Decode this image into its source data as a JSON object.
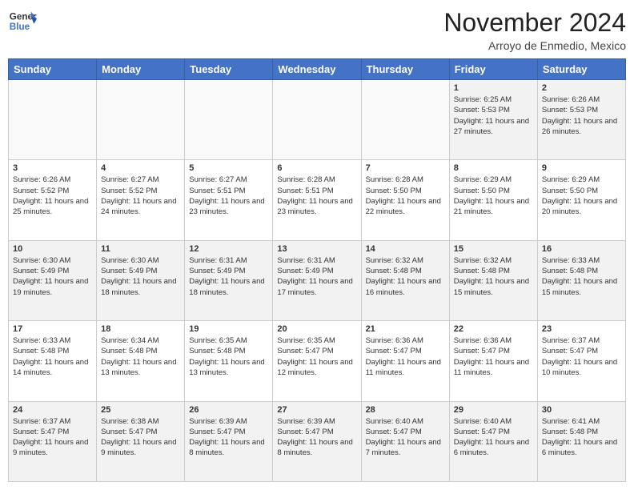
{
  "logo": {
    "line1": "General",
    "line2": "Blue"
  },
  "title": "November 2024",
  "location": "Arroyo de Enmedio, Mexico",
  "days_of_week": [
    "Sunday",
    "Monday",
    "Tuesday",
    "Wednesday",
    "Thursday",
    "Friday",
    "Saturday"
  ],
  "weeks": [
    [
      {
        "day": "",
        "info": ""
      },
      {
        "day": "",
        "info": ""
      },
      {
        "day": "",
        "info": ""
      },
      {
        "day": "",
        "info": ""
      },
      {
        "day": "",
        "info": ""
      },
      {
        "day": "1",
        "info": "Sunrise: 6:25 AM\nSunset: 5:53 PM\nDaylight: 11 hours and 27 minutes."
      },
      {
        "day": "2",
        "info": "Sunrise: 6:26 AM\nSunset: 5:53 PM\nDaylight: 11 hours and 26 minutes."
      }
    ],
    [
      {
        "day": "3",
        "info": "Sunrise: 6:26 AM\nSunset: 5:52 PM\nDaylight: 11 hours and 25 minutes."
      },
      {
        "day": "4",
        "info": "Sunrise: 6:27 AM\nSunset: 5:52 PM\nDaylight: 11 hours and 24 minutes."
      },
      {
        "day": "5",
        "info": "Sunrise: 6:27 AM\nSunset: 5:51 PM\nDaylight: 11 hours and 23 minutes."
      },
      {
        "day": "6",
        "info": "Sunrise: 6:28 AM\nSunset: 5:51 PM\nDaylight: 11 hours and 23 minutes."
      },
      {
        "day": "7",
        "info": "Sunrise: 6:28 AM\nSunset: 5:50 PM\nDaylight: 11 hours and 22 minutes."
      },
      {
        "day": "8",
        "info": "Sunrise: 6:29 AM\nSunset: 5:50 PM\nDaylight: 11 hours and 21 minutes."
      },
      {
        "day": "9",
        "info": "Sunrise: 6:29 AM\nSunset: 5:50 PM\nDaylight: 11 hours and 20 minutes."
      }
    ],
    [
      {
        "day": "10",
        "info": "Sunrise: 6:30 AM\nSunset: 5:49 PM\nDaylight: 11 hours and 19 minutes."
      },
      {
        "day": "11",
        "info": "Sunrise: 6:30 AM\nSunset: 5:49 PM\nDaylight: 11 hours and 18 minutes."
      },
      {
        "day": "12",
        "info": "Sunrise: 6:31 AM\nSunset: 5:49 PM\nDaylight: 11 hours and 18 minutes."
      },
      {
        "day": "13",
        "info": "Sunrise: 6:31 AM\nSunset: 5:49 PM\nDaylight: 11 hours and 17 minutes."
      },
      {
        "day": "14",
        "info": "Sunrise: 6:32 AM\nSunset: 5:48 PM\nDaylight: 11 hours and 16 minutes."
      },
      {
        "day": "15",
        "info": "Sunrise: 6:32 AM\nSunset: 5:48 PM\nDaylight: 11 hours and 15 minutes."
      },
      {
        "day": "16",
        "info": "Sunrise: 6:33 AM\nSunset: 5:48 PM\nDaylight: 11 hours and 15 minutes."
      }
    ],
    [
      {
        "day": "17",
        "info": "Sunrise: 6:33 AM\nSunset: 5:48 PM\nDaylight: 11 hours and 14 minutes."
      },
      {
        "day": "18",
        "info": "Sunrise: 6:34 AM\nSunset: 5:48 PM\nDaylight: 11 hours and 13 minutes."
      },
      {
        "day": "19",
        "info": "Sunrise: 6:35 AM\nSunset: 5:48 PM\nDaylight: 11 hours and 13 minutes."
      },
      {
        "day": "20",
        "info": "Sunrise: 6:35 AM\nSunset: 5:47 PM\nDaylight: 11 hours and 12 minutes."
      },
      {
        "day": "21",
        "info": "Sunrise: 6:36 AM\nSunset: 5:47 PM\nDaylight: 11 hours and 11 minutes."
      },
      {
        "day": "22",
        "info": "Sunrise: 6:36 AM\nSunset: 5:47 PM\nDaylight: 11 hours and 11 minutes."
      },
      {
        "day": "23",
        "info": "Sunrise: 6:37 AM\nSunset: 5:47 PM\nDaylight: 11 hours and 10 minutes."
      }
    ],
    [
      {
        "day": "24",
        "info": "Sunrise: 6:37 AM\nSunset: 5:47 PM\nDaylight: 11 hours and 9 minutes."
      },
      {
        "day": "25",
        "info": "Sunrise: 6:38 AM\nSunset: 5:47 PM\nDaylight: 11 hours and 9 minutes."
      },
      {
        "day": "26",
        "info": "Sunrise: 6:39 AM\nSunset: 5:47 PM\nDaylight: 11 hours and 8 minutes."
      },
      {
        "day": "27",
        "info": "Sunrise: 6:39 AM\nSunset: 5:47 PM\nDaylight: 11 hours and 8 minutes."
      },
      {
        "day": "28",
        "info": "Sunrise: 6:40 AM\nSunset: 5:47 PM\nDaylight: 11 hours and 7 minutes."
      },
      {
        "day": "29",
        "info": "Sunrise: 6:40 AM\nSunset: 5:47 PM\nDaylight: 11 hours and 6 minutes."
      },
      {
        "day": "30",
        "info": "Sunrise: 6:41 AM\nSunset: 5:48 PM\nDaylight: 11 hours and 6 minutes."
      }
    ]
  ]
}
